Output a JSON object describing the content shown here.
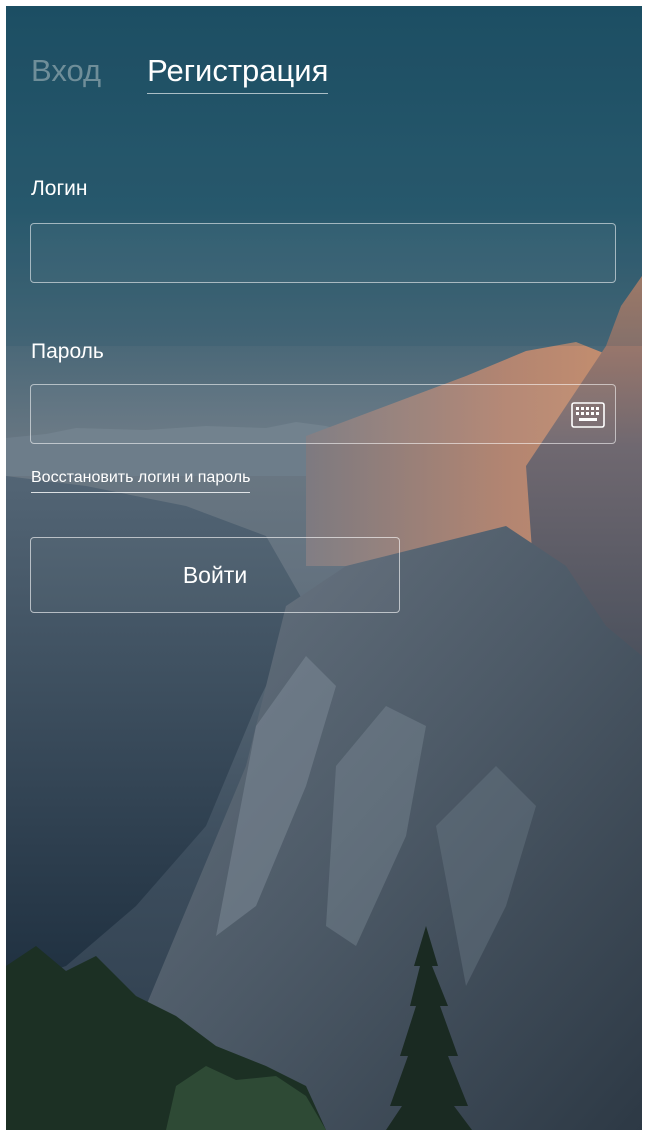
{
  "tabs": {
    "login": "Вход",
    "register": "Регистрация"
  },
  "form": {
    "login_label": "Логин",
    "login_value": "",
    "password_label": "Пароль",
    "password_value": "",
    "keyboard_icon": "keyboard-icon",
    "recover_link": "Восстановить логин и пароль",
    "submit_label": "Войти"
  },
  "colors": {
    "active_tab": "#ffffff",
    "inactive_tab": "#6f8e99",
    "sky_top": "#1d4e63",
    "sunlit_rock": "#c08a6a"
  }
}
